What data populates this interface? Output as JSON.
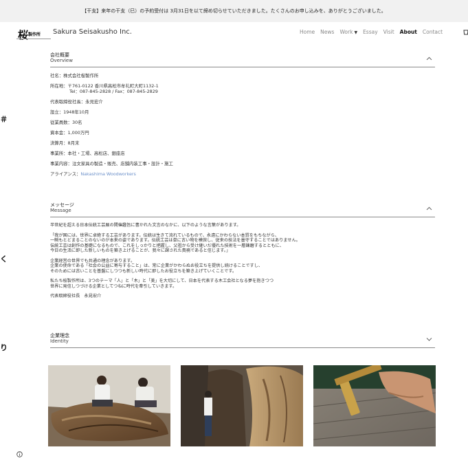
{
  "announcement": "【干支】来年の干支（巳）の予約受付は 3月31日を以て締め切らせていただきました。たくさんのお申し込みを、ありがとうございました。",
  "header": {
    "logo_mark": "桜",
    "logo_small": "製作所",
    "brand": "Sakura Seisakusho Inc.",
    "nav": {
      "home": "Home",
      "news": "News",
      "work": "Work",
      "essay": "Essay",
      "visit": "Visit",
      "about": "About",
      "contact": "Contact"
    },
    "cart_icon": "cart-icon"
  },
  "side_strip": [
    "＃",
    "く",
    "り"
  ],
  "overview": {
    "title_jp": "会社概要",
    "title_en": "Overview",
    "toggle": "^",
    "rows": {
      "name": "社名：株式会社桜製作所",
      "address1": "所在地：〒761-0122 香川県高松市牟礼町大町1132-1",
      "address2": "Tel：087-845-2828 / Fax：087-845-2829",
      "ceo": "代表取締役社長：永見宏介",
      "founded": "設立：1948年10月",
      "employees": "従業員数：30名",
      "capital": "資本金：1,000万円",
      "fiscal": "決算月：8月末",
      "offices": "事業所：本社・工場、高松店、銀座店",
      "business": "事業内容：注文家具の製造・販売、店舗内装工事・設計・施工",
      "alliance_label": "アライアンス：",
      "alliance_link": "Nakashima Woodworkers"
    }
  },
  "message": {
    "title_jp": "メッセージ",
    "title_en": "Message",
    "toggle": "^",
    "p1": "半世紀を超える日本伝統工芸展の開催趣旨に書かれた文言のなかに、以下のような言葉があります。",
    "p2a": "「我が国には、世界に卓絶する工芸があります。伝統は生きて流れているもので、永遠にかわらない本質をもちながら、",
    "p2b": "一瞬もとどまることのないのが本来の姿であります。伝統工芸は単に古い物を模倣し、従来の技法を墨守することではありません。",
    "p2c": "伝統工芸は創作の基礎になるもので、これをしっかりと把握し、父祖から受け継いだ優れた技術を一層錬磨するとともに、",
    "p2d": "今日の生活に即した新しいものを築き上げることが、我々に課された責務であると信じます。」",
    "p3a": "企業経営の世界でも共通の理念があります。",
    "p3b": "企業の使命である「社会の公益に寄与すること」は、常に企業がかわらぬお役立ちを提供し続けることですし、",
    "p3c": "そのためには古いことを基盤にしつつも新しい時代に即したお役立ちを築き上げていくことです。",
    "p4a": "私たち桜製作所は、3つのテーマ「人」と「木」と「美」を大切にして、日本を代表する木工会社となる夢を抱きつつ",
    "p4b": "世界に発信しつづける企業としてつねに時代を牽引していきます。",
    "p5": "代表取締役社長　永見宏介"
  },
  "identity": {
    "title_jp": "企業理念",
    "title_en": "Identity",
    "toggle": "v"
  },
  "photos": [
    "workers-on-wood-slab-photo",
    "man-with-tall-wood-slab-photo",
    "hand-with-marking-gauge-photo"
  ],
  "info_icon": "info-icon"
}
